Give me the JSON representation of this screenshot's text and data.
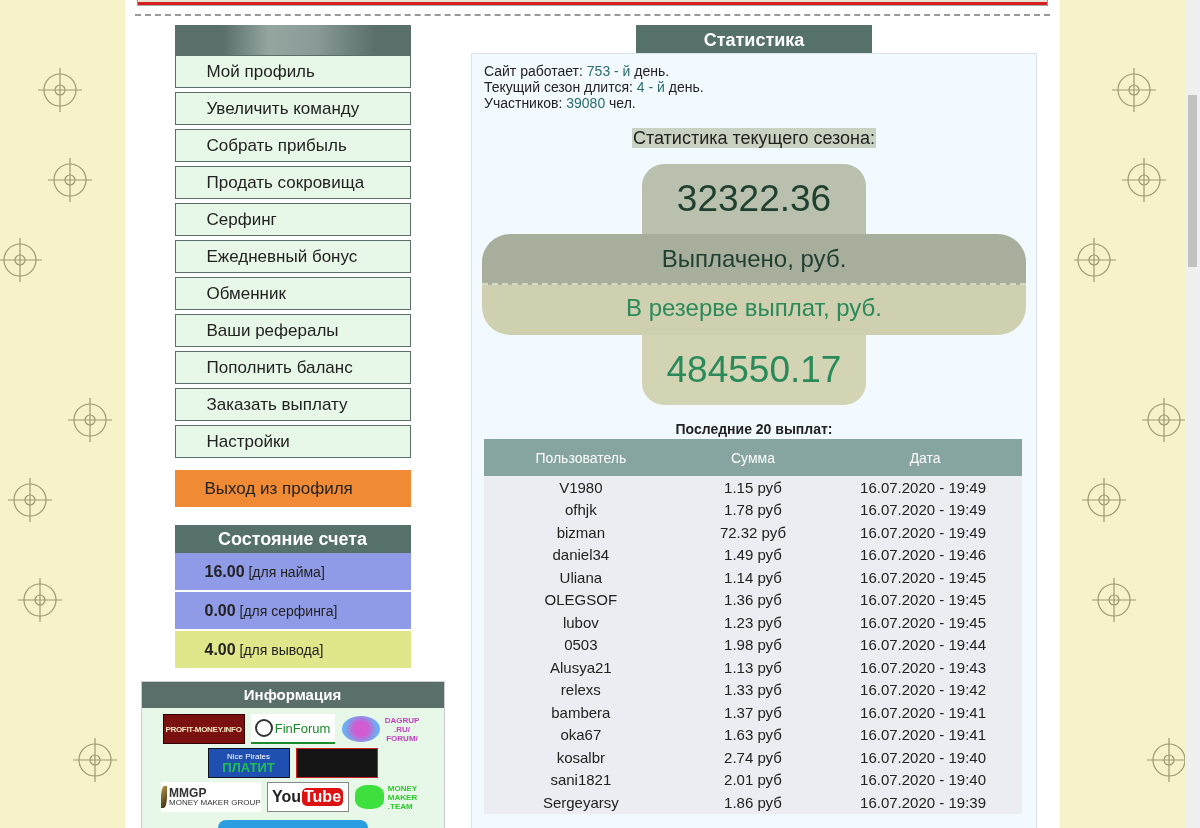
{
  "menu": {
    "items": [
      "Мой профиль",
      "Увеличить команду",
      "Собрать прибыль",
      "Продать сокровища",
      "Серфинг",
      "Ежедневный бонус",
      "Обменник",
      "Ваши рефералы",
      "Пополнить баланс",
      "Заказать выплату",
      "Настройки"
    ],
    "logout": "Выход из профиля"
  },
  "account": {
    "title": "Состояние счета",
    "balances": [
      {
        "amount": "16.00",
        "note": "[для найма]",
        "color": "#8f9be6"
      },
      {
        "amount": "0.00",
        "note": "[для серфинга]",
        "color": "#8f9be6"
      },
      {
        "amount": "4.00",
        "note": "[для вывода]",
        "color": "#e0e68a"
      }
    ]
  },
  "info": {
    "title": "Информация",
    "banners": [
      {
        "kind": "profit",
        "text": "PROFIT-MONEY.INFO"
      },
      {
        "kind": "finforum",
        "text": "FinForum"
      },
      {
        "kind": "dagrup",
        "text": "DAGRUP .RU/ FORUM/"
      },
      {
        "kind": "pirates",
        "text": "Nice Pirates",
        "subtext": "ПЛАТИТ"
      },
      {
        "kind": "dark"
      },
      {
        "kind": "mmgp",
        "text": "MMGP",
        "subtext": "MONEY MAKER GROUP"
      },
      {
        "kind": "youtube",
        "text": "You",
        "subtext": "Tube"
      },
      {
        "kind": "moneymaker",
        "text": "MONEY MAKER .TEAM"
      },
      {
        "kind": "button"
      }
    ]
  },
  "stats": {
    "title": "Статистика",
    "lines": [
      {
        "label": "Сайт работает: ",
        "value": "753 - й",
        "suffix": " день."
      },
      {
        "label": "Текущий сезон длится: ",
        "value": "4 - й",
        "suffix": " день."
      },
      {
        "label": "Участников: ",
        "value": "39080",
        "suffix": " чел."
      }
    ],
    "season_title": "Статистика текущего сезона:",
    "paid_amount": "32322.36",
    "paid_label": "Выплачено, руб.",
    "reserve_label": "В резерве выплат, руб.",
    "reserve_amount": "484550.17"
  },
  "payouts": {
    "title": "Последние 20 выплат:",
    "columns": [
      "Пользователь",
      "Сумма",
      "Дата"
    ],
    "rows": [
      [
        "V1980",
        "1.15 руб",
        "16.07.2020 - 19:49"
      ],
      [
        "ofhjk",
        "1.78 руб",
        "16.07.2020 - 19:49"
      ],
      [
        "bizman",
        "72.32 руб",
        "16.07.2020 - 19:49"
      ],
      [
        "daniel34",
        "1.49 руб",
        "16.07.2020 - 19:46"
      ],
      [
        "Uliana",
        "1.14 руб",
        "16.07.2020 - 19:45"
      ],
      [
        "OLEGSOF",
        "1.36 руб",
        "16.07.2020 - 19:45"
      ],
      [
        "lubov",
        "1.23 руб",
        "16.07.2020 - 19:45"
      ],
      [
        "0503",
        "1.98 руб",
        "16.07.2020 - 19:44"
      ],
      [
        "Alusya21",
        "1.13 руб",
        "16.07.2020 - 19:43"
      ],
      [
        "relexs",
        "1.33 руб",
        "16.07.2020 - 19:42"
      ],
      [
        "bambera",
        "1.37 руб",
        "16.07.2020 - 19:41"
      ],
      [
        "oka67",
        "1.63 руб",
        "16.07.2020 - 19:41"
      ],
      [
        "kosalbr",
        "2.74 руб",
        "16.07.2020 - 19:40"
      ],
      [
        "sani1821",
        "2.01 руб",
        "16.07.2020 - 19:40"
      ],
      [
        "Sergeyarsy",
        "1.86 руб",
        "16.07.2020 - 19:39"
      ]
    ]
  }
}
